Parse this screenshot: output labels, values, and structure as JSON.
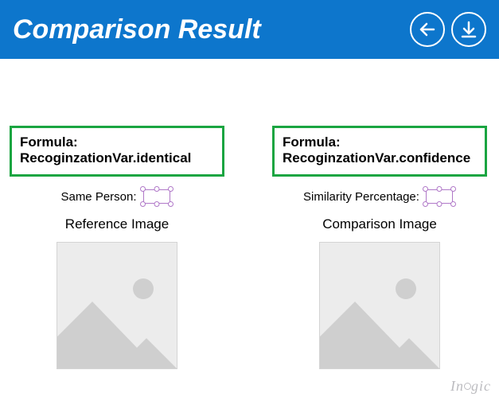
{
  "header": {
    "title": "Comparison Result"
  },
  "left": {
    "formula_label": "Formula:",
    "formula_value": "RecoginzationVar.identical",
    "field_label": "Same Person:",
    "image_label": "Reference Image"
  },
  "right": {
    "formula_label": "Formula:",
    "formula_value": "RecoginzationVar.confidence",
    "field_label": "Similarity Percentage:",
    "image_label": "Comparison Image"
  },
  "watermark": {
    "prefix": "In",
    "suffix": "gic"
  }
}
